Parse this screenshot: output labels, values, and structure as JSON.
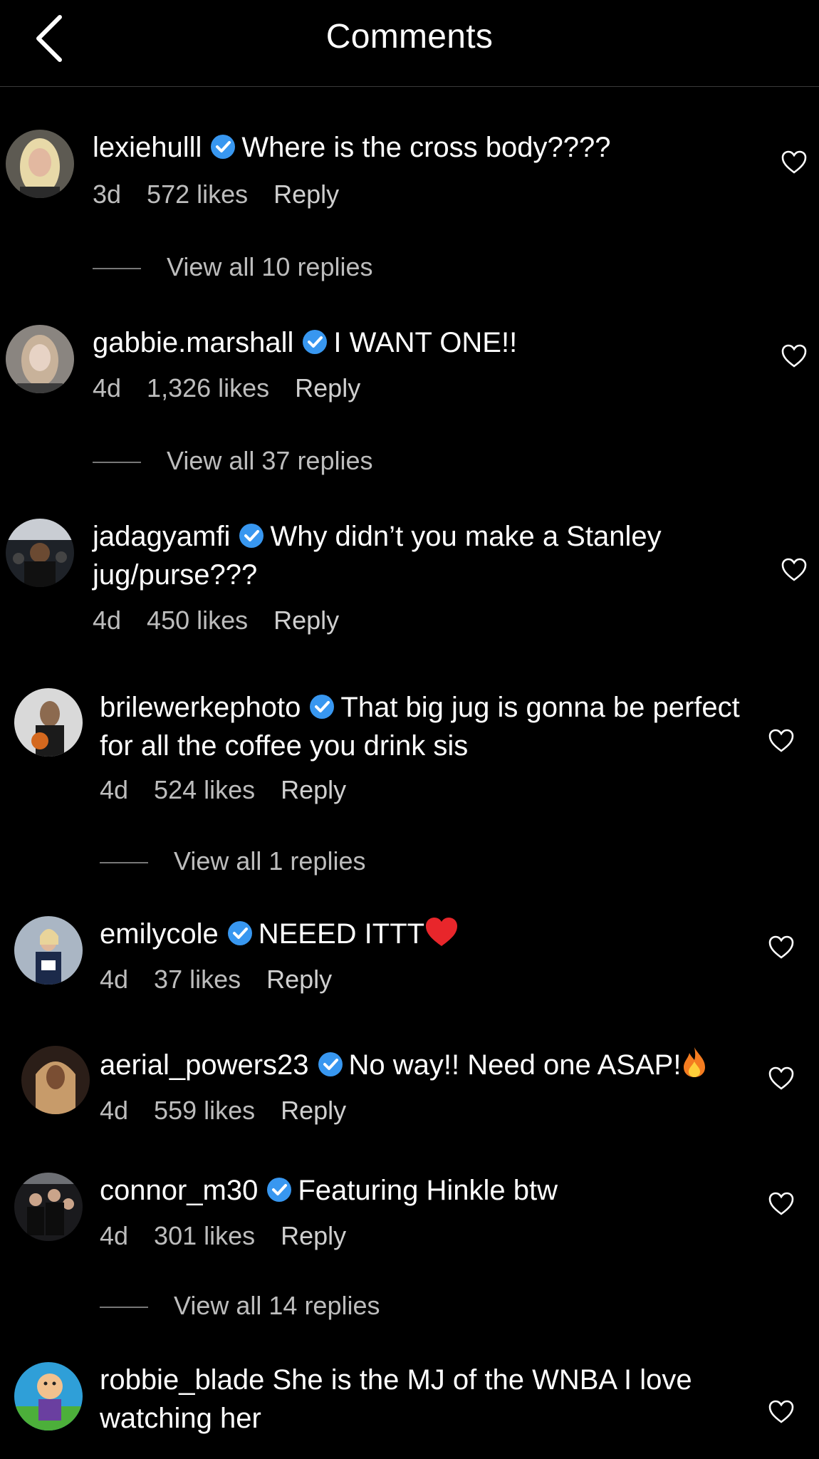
{
  "header": {
    "title": "Comments",
    "back_icon": "chevron-left-icon"
  },
  "comments": [
    {
      "username": "lexiehulll",
      "verified": true,
      "text": "Where is the cross body????",
      "time": "3d",
      "likes": "572 likes",
      "reply": "Reply",
      "view_replies": "View all 10 replies"
    },
    {
      "username": "gabbie.marshall",
      "verified": true,
      "text": "I WANT ONE!!",
      "time": "4d",
      "likes": "1,326 likes",
      "reply": "Reply",
      "view_replies": "View all 37 replies"
    },
    {
      "username": "jadagyamfi",
      "verified": true,
      "text": "Why didn’t you make a Stanley jug/purse???",
      "time": "4d",
      "likes": "450 likes",
      "reply": "Reply"
    },
    {
      "username": "brilewerkephoto",
      "verified": true,
      "text": "That big jug is gonna be perfect for all the coffee you drink sis",
      "time": "4d",
      "likes": "524 likes",
      "reply": "Reply",
      "view_replies": "View all 1 replies"
    },
    {
      "username": "emilycole",
      "verified": true,
      "text": "NEEED ITTT",
      "emoji": "red-heart",
      "time": "4d",
      "likes": "37 likes",
      "reply": "Reply"
    },
    {
      "username": "aerial_powers23",
      "verified": true,
      "text": "No way!! Need one ASAP!",
      "emoji": "fire",
      "time": "4d",
      "likes": "559 likes",
      "reply": "Reply"
    },
    {
      "username": "connor_m30",
      "verified": true,
      "text": "Featuring Hinkle btw",
      "time": "4d",
      "likes": "301 likes",
      "reply": "Reply",
      "view_replies": "View all 14 replies"
    },
    {
      "username": "robbie_blade",
      "verified": false,
      "text": "She is the MJ of the WNBA I love watching her"
    }
  ],
  "colors": {
    "background": "#000000",
    "text": "#ffffff",
    "meta_text": "#bdbdbd",
    "verified_badge": "#3897f0",
    "divider": "#3a3a3a"
  }
}
